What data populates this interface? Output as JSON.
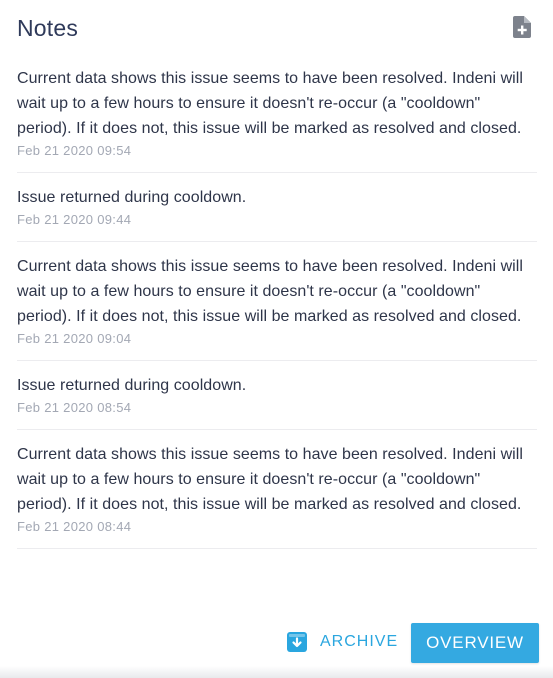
{
  "header": {
    "title": "Notes",
    "add_icon": "add-document-icon"
  },
  "notes": [
    {
      "text": "Current data shows this issue seems to have been resolved. Indeni will wait up to a few hours to ensure it doesn't re-occur (a \"cooldown\" period). If it does not, this issue will be marked as resolved and closed.",
      "time": "Feb 21 2020 09:54"
    },
    {
      "text": "Issue returned during cooldown.",
      "time": "Feb 21 2020 09:44"
    },
    {
      "text": "Current data shows this issue seems to have been resolved. Indeni will wait up to a few hours to ensure it doesn't re-occur (a \"cooldown\" period). If it does not, this issue will be marked as resolved and closed.",
      "time": "Feb 21 2020 09:04"
    },
    {
      "text": "Issue returned during cooldown.",
      "time": "Feb 21 2020 08:54"
    },
    {
      "text": "Current data shows this issue seems to have been resolved. Indeni will wait up to a few hours to ensure it doesn't re-occur (a \"cooldown\" period). If it does not, this issue will be marked as resolved and closed.",
      "time": "Feb 21 2020 08:44"
    }
  ],
  "footer": {
    "archive_label": "ARCHIVE",
    "archive_icon": "archive-box-icon",
    "overview_label": "OVERVIEW"
  },
  "colors": {
    "title": "#2f3a5a",
    "text": "#2e3549",
    "timestamp": "#a3a8b4",
    "accent": "#34a9e1"
  }
}
